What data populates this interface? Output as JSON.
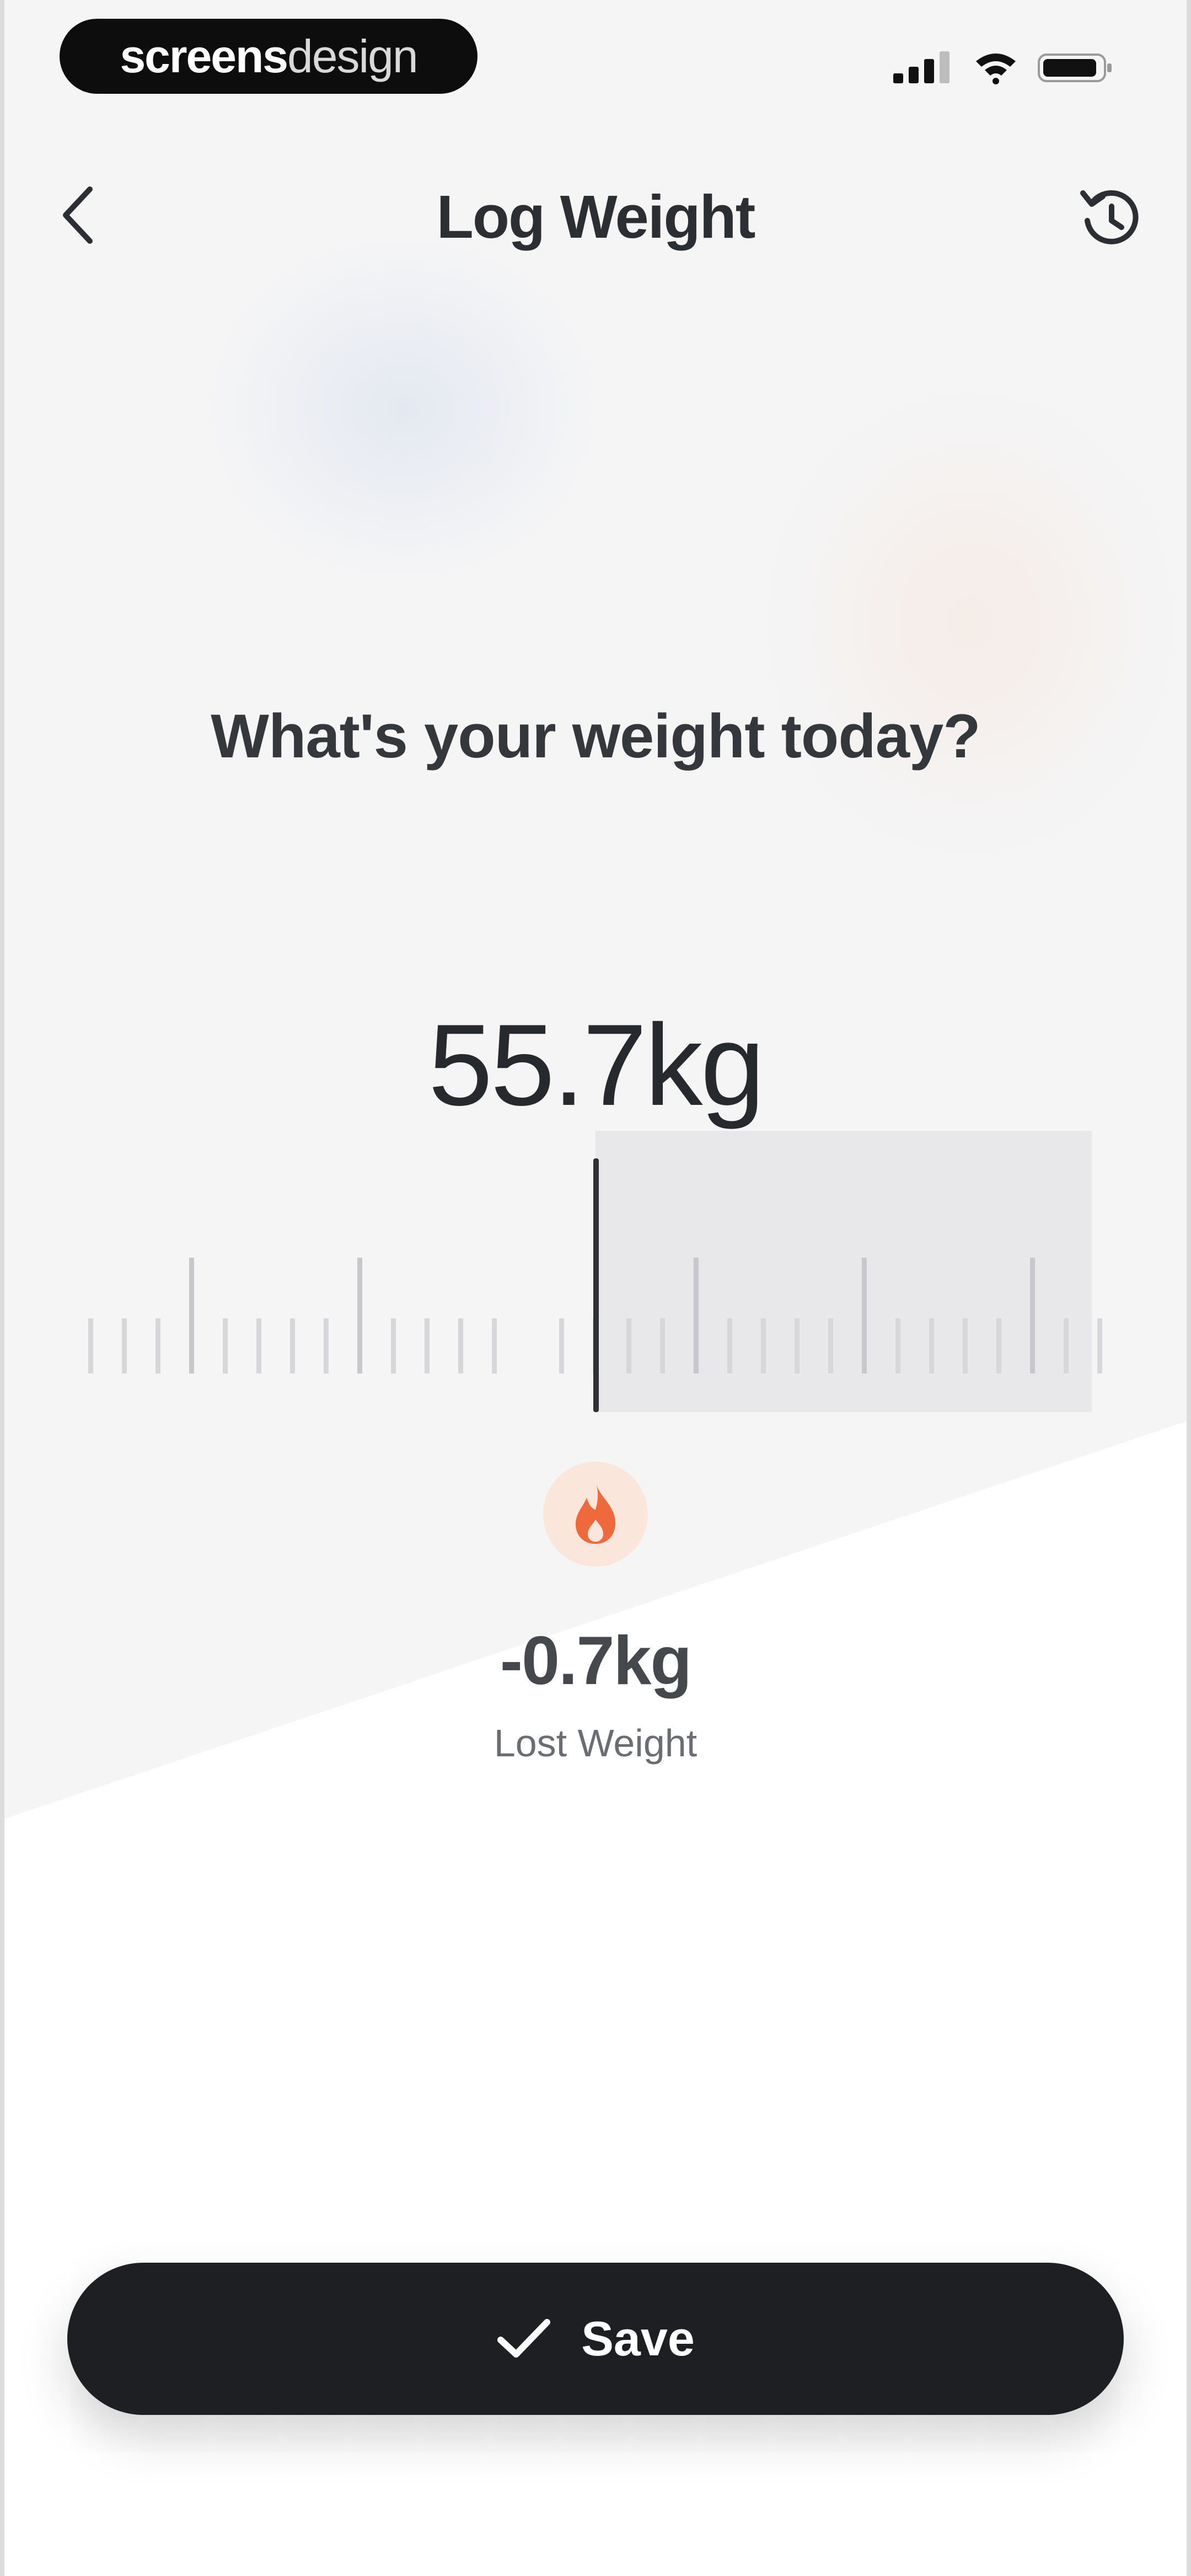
{
  "status_bar": {
    "brand_bold": "screens",
    "brand_light": "design",
    "icons": [
      "signal-icon",
      "wifi-icon",
      "battery-icon"
    ]
  },
  "nav": {
    "title": "Log Weight",
    "back_icon": "chevron-left-icon",
    "history_icon": "history-icon"
  },
  "prompt": {
    "question": "What's your weight today?"
  },
  "weight": {
    "value_label": "55.7kg"
  },
  "change": {
    "icon": "flame-icon",
    "value_label": "-0.7kg",
    "caption": "Lost Weight"
  },
  "actions": {
    "save_label": "Save",
    "save_icon": "checkmark-icon"
  },
  "colors": {
    "accent": "#ee6a3d",
    "accent_soft": "#fbe6dc",
    "button": "#1d1f23",
    "text": "#2b2e33"
  }
}
